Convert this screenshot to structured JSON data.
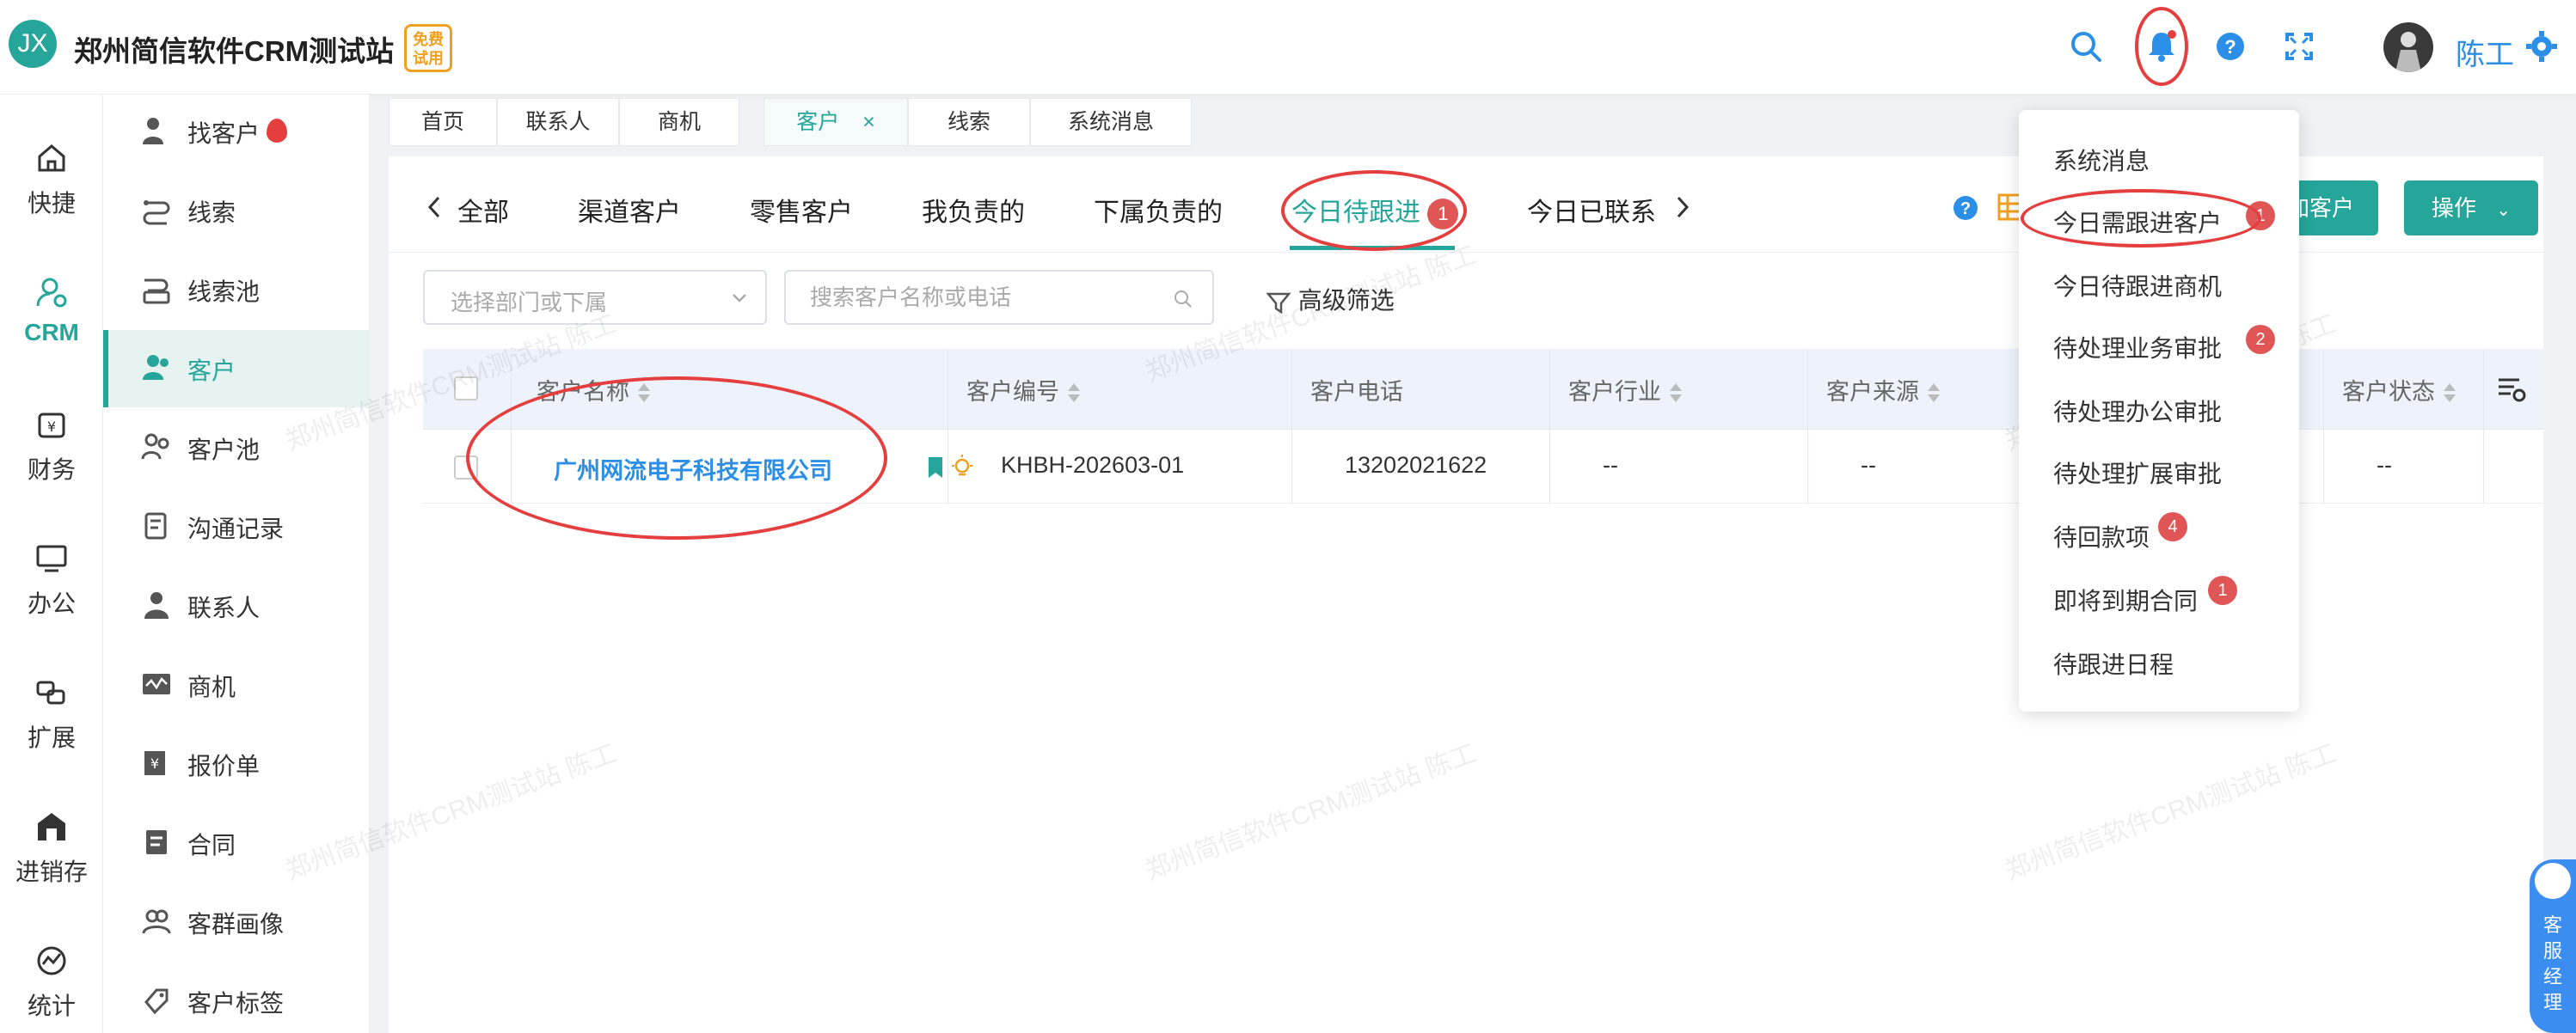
{
  "header": {
    "logo": "JX",
    "title": "郑州简信软件CRM测试站",
    "trial_badge": "免费试用",
    "user_name": "陈工"
  },
  "rail": [
    {
      "label": "快捷",
      "icon": "home-icon"
    },
    {
      "label": "CRM",
      "icon": "crm-icon"
    },
    {
      "label": "财务",
      "icon": "finance-icon"
    },
    {
      "label": "办公",
      "icon": "monitor-icon"
    },
    {
      "label": "扩展",
      "icon": "extend-icon"
    },
    {
      "label": "进销存",
      "icon": "store-icon"
    },
    {
      "label": "统计",
      "icon": "stats-icon"
    }
  ],
  "subnav": [
    {
      "label": "找客户"
    },
    {
      "label": "线索"
    },
    {
      "label": "线索池"
    },
    {
      "label": "客户"
    },
    {
      "label": "客户池"
    },
    {
      "label": "沟通记录"
    },
    {
      "label": "联系人"
    },
    {
      "label": "商机"
    },
    {
      "label": "报价单"
    },
    {
      "label": "合同"
    },
    {
      "label": "客群画像"
    },
    {
      "label": "客户标签"
    }
  ],
  "page_tabs": [
    {
      "label": "首页"
    },
    {
      "label": "联系人"
    },
    {
      "label": "商机"
    },
    {
      "label": "客户",
      "close": "×"
    },
    {
      "label": "线索"
    },
    {
      "label": "系统消息"
    }
  ],
  "content_tabs": {
    "all": "全部",
    "channel": "渠道客户",
    "retail": "零售客户",
    "mine": "我负责的",
    "subordinate": "下属负责的",
    "today_follow": "今日待跟进",
    "today_follow_count": "1",
    "today_contacted": "今日已联系"
  },
  "actions": {
    "add_customer": "加客户",
    "operate": "操作"
  },
  "filters": {
    "dept_placeholder": "选择部门或下属",
    "search_placeholder": "搜索客户名称或电话",
    "advanced_filter": "高级筛选"
  },
  "table": {
    "columns": [
      "客户名称",
      "客户编号",
      "客户电话",
      "客户行业",
      "客户来源",
      "客户状态"
    ],
    "rows": [
      {
        "name": "广州网流电子科技有限公司",
        "code": "KHBH-202603-01",
        "phone": "13202021622",
        "industry": "--",
        "source": "--",
        "status": "--"
      }
    ]
  },
  "dropdown": {
    "items": [
      {
        "label": "系统消息",
        "badge": ""
      },
      {
        "label": "今日需跟进客户",
        "badge": "1"
      },
      {
        "label": "今日待跟进商机",
        "badge": ""
      },
      {
        "label": "待处理业务审批",
        "badge": "2"
      },
      {
        "label": "待处理办公审批",
        "badge": ""
      },
      {
        "label": "待处理扩展审批",
        "badge": ""
      },
      {
        "label": "待回款项",
        "badge": "4"
      },
      {
        "label": "即将到期合同",
        "badge": "1"
      },
      {
        "label": "待跟进日程",
        "badge": ""
      }
    ]
  },
  "watermark": "郑州简信软件CRM测试站 陈工",
  "float_service": "客服经理",
  "colors": {
    "brand": "#26a69a",
    "link": "#2b8fe8",
    "badge": "#e05656",
    "highlight": "#e53e3e"
  }
}
